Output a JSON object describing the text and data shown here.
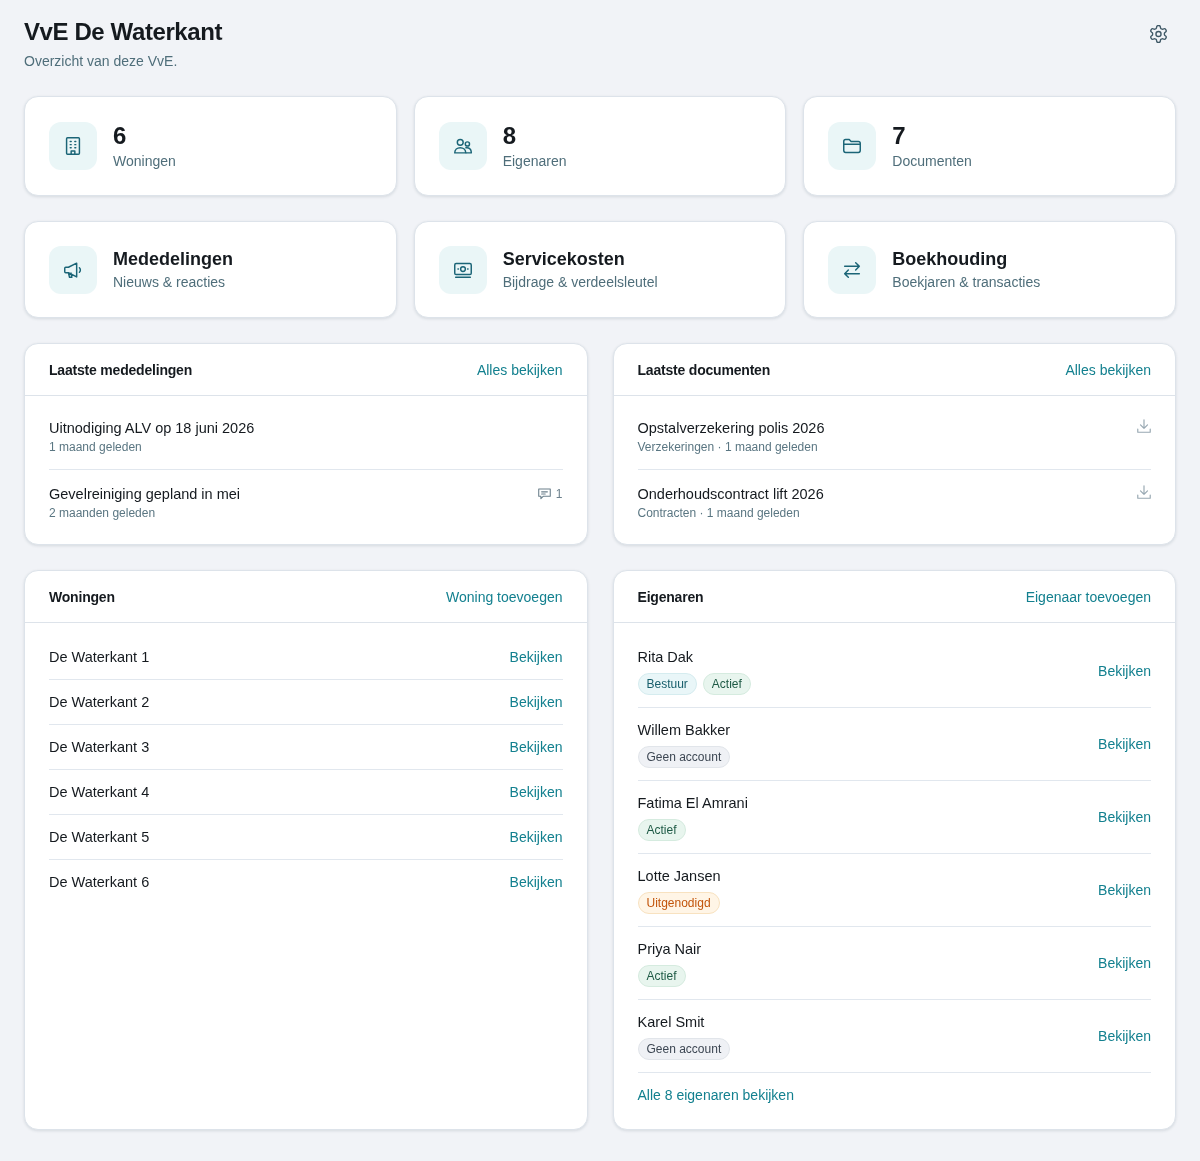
{
  "header": {
    "title": "VvE De Waterkant",
    "subtitle": "Overzicht van deze VvE."
  },
  "stats": [
    {
      "value": "6",
      "label": "Woningen"
    },
    {
      "value": "8",
      "label": "Eigenaren"
    },
    {
      "value": "7",
      "label": "Documenten"
    }
  ],
  "shortcuts": [
    {
      "title": "Mededelingen",
      "subtitle": "Nieuws & reacties"
    },
    {
      "title": "Servicekosten",
      "subtitle": "Bijdrage & verdeelsleutel"
    },
    {
      "title": "Boekhouding",
      "subtitle": "Boekjaren & transacties"
    }
  ],
  "announcements": {
    "title": "Laatste mededelingen",
    "link": "Alles bekijken",
    "items": [
      {
        "title": "Uitnodiging ALV op 18 juni 2026",
        "time": "1 maand geleden"
      },
      {
        "title": "Gevelreiniging gepland in mei",
        "time": "2 maanden geleden",
        "comments": "1"
      }
    ]
  },
  "documents": {
    "title": "Laatste documenten",
    "link": "Alles bekijken",
    "items": [
      {
        "title": "Opstalverzekering polis 2026",
        "meta": "Verzekeringen · 1 maand geleden"
      },
      {
        "title": "Onderhoudscontract lift 2026",
        "meta": "Contracten · 1 maand geleden"
      }
    ]
  },
  "units": {
    "title": "Woningen",
    "action": "Woning toevoegen",
    "rows": [
      {
        "name": "De Waterkant 1",
        "link": "Bekijken"
      },
      {
        "name": "De Waterkant 2",
        "link": "Bekijken"
      },
      {
        "name": "De Waterkant 3",
        "link": "Bekijken"
      },
      {
        "name": "De Waterkant 4",
        "link": "Bekijken"
      },
      {
        "name": "De Waterkant 5",
        "link": "Bekijken"
      },
      {
        "name": "De Waterkant 6",
        "link": "Bekijken"
      }
    ]
  },
  "owners": {
    "title": "Eigenaren",
    "action": "Eigenaar toevoegen",
    "rows": [
      {
        "name": "Rita Dak",
        "tags": [
          {
            "label": "Bestuur",
            "kind": "role"
          },
          {
            "label": "Actief",
            "kind": "active"
          }
        ],
        "link": "Bekijken"
      },
      {
        "name": "Willem Bakker",
        "tags": [
          {
            "label": "Geen account",
            "kind": "none"
          }
        ],
        "link": "Bekijken"
      },
      {
        "name": "Fatima El Amrani",
        "tags": [
          {
            "label": "Actief",
            "kind": "active"
          }
        ],
        "link": "Bekijken"
      },
      {
        "name": "Lotte Jansen",
        "tags": [
          {
            "label": "Uitgenodigd",
            "kind": "invited"
          }
        ],
        "link": "Bekijken"
      },
      {
        "name": "Priya Nair",
        "tags": [
          {
            "label": "Actief",
            "kind": "active"
          }
        ],
        "link": "Bekijken"
      },
      {
        "name": "Karel Smit",
        "tags": [
          {
            "label": "Geen account",
            "kind": "none"
          }
        ],
        "link": "Bekijken"
      }
    ],
    "footer_link": "Alle 8 eigenaren bekijken"
  }
}
